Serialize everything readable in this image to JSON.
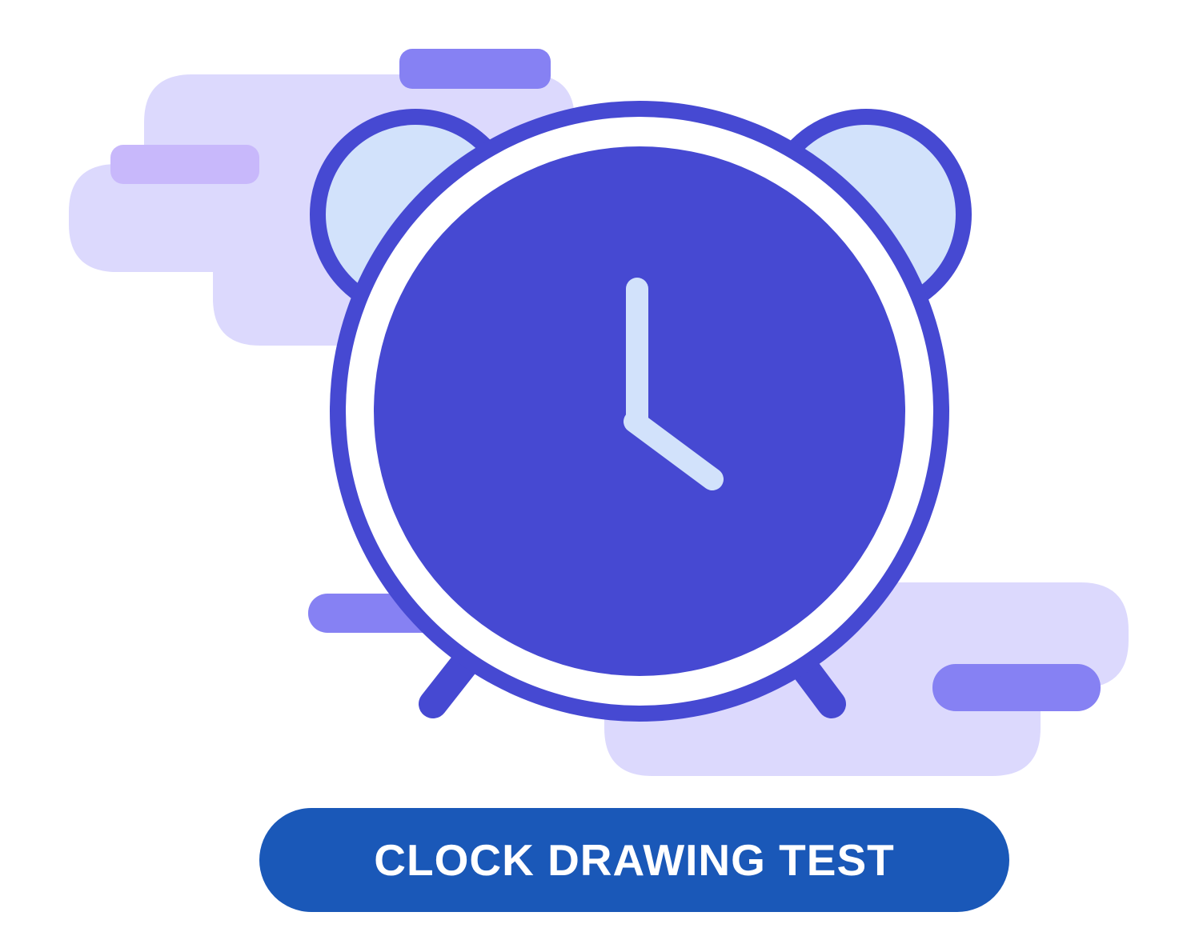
{
  "cta": {
    "label": "CLOCK DRAWING TEST"
  },
  "illustration": {
    "icon": "alarm-clock-icon",
    "clock_time": "4:00"
  },
  "colors": {
    "background": "#ffffff",
    "cloud_light": "#dcd9fd",
    "bar_medium": "#8681f3",
    "bar_lavender": "#c8b8fb",
    "clock_outline": "#4649d2",
    "clock_face": "#4649d2",
    "bell_fill": "#d2e2fb",
    "clock_hands": "#d2e2fb",
    "button_bg": "#1a58b8",
    "button_text": "#ffffff"
  }
}
